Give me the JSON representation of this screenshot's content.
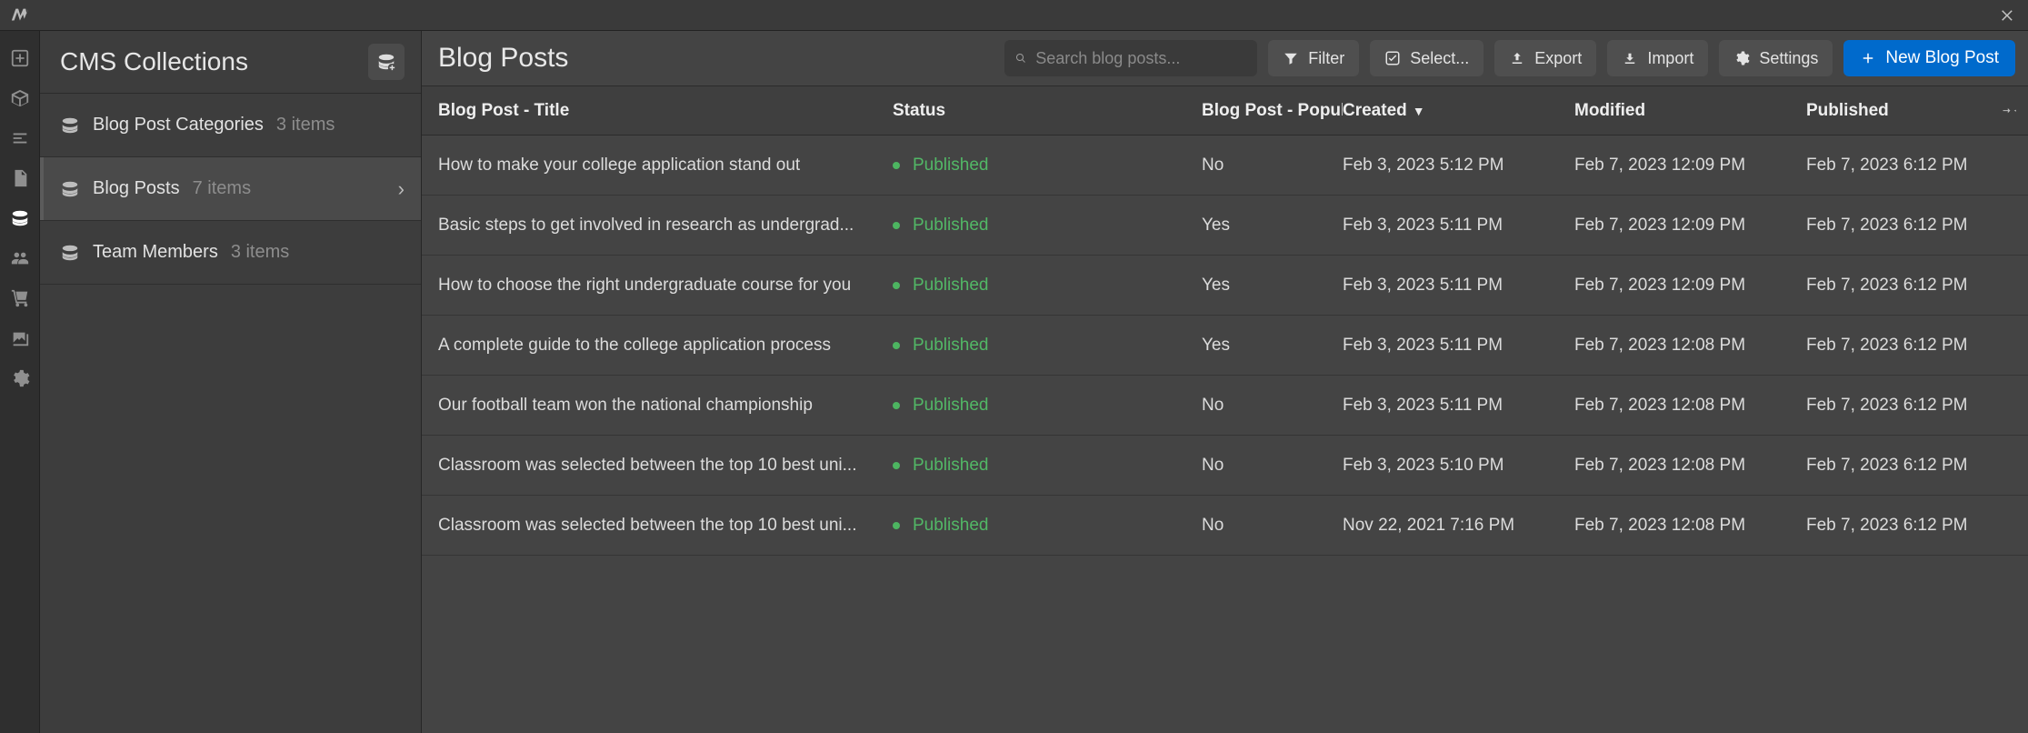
{
  "sidebar": {
    "title": "CMS Collections",
    "items": [
      {
        "name": "Blog Post Categories",
        "count": "3 items",
        "active": false
      },
      {
        "name": "Blog Posts",
        "count": "7 items",
        "active": true
      },
      {
        "name": "Team Members",
        "count": "3 items",
        "active": false
      }
    ]
  },
  "header": {
    "title": "Blog Posts",
    "search_placeholder": "Search blog posts...",
    "filter": "Filter",
    "select": "Select...",
    "export": "Export",
    "import": "Import",
    "settings": "Settings",
    "new": "New Blog Post"
  },
  "table": {
    "columns": {
      "title": "Blog Post - Title",
      "status": "Status",
      "popular": "Blog Post - Popular",
      "created": "Created",
      "modified": "Modified",
      "published": "Published"
    },
    "sort_indicator": "▼",
    "rows": [
      {
        "title": "How to make your college application stand out",
        "status": "Published",
        "popular": "No",
        "created": "Feb 3, 2023 5:12 PM",
        "modified": "Feb 7, 2023 12:09 PM",
        "published": "Feb 7, 2023 6:12 PM"
      },
      {
        "title": "Basic steps to get involved in research as undergrad...",
        "status": "Published",
        "popular": "Yes",
        "created": "Feb 3, 2023 5:11 PM",
        "modified": "Feb 7, 2023 12:09 PM",
        "published": "Feb 7, 2023 6:12 PM"
      },
      {
        "title": "How to choose the right undergraduate course for you",
        "status": "Published",
        "popular": "Yes",
        "created": "Feb 3, 2023 5:11 PM",
        "modified": "Feb 7, 2023 12:09 PM",
        "published": "Feb 7, 2023 6:12 PM"
      },
      {
        "title": "A complete guide to the college application process",
        "status": "Published",
        "popular": "Yes",
        "created": "Feb 3, 2023 5:11 PM",
        "modified": "Feb 7, 2023 12:08 PM",
        "published": "Feb 7, 2023 6:12 PM"
      },
      {
        "title": "Our football team won the national championship",
        "status": "Published",
        "popular": "No",
        "created": "Feb 3, 2023 5:11 PM",
        "modified": "Feb 7, 2023 12:08 PM",
        "published": "Feb 7, 2023 6:12 PM"
      },
      {
        "title": "Classroom was selected between the top 10 best uni...",
        "status": "Published",
        "popular": "No",
        "created": "Feb 3, 2023 5:10 PM",
        "modified": "Feb 7, 2023 12:08 PM",
        "published": "Feb 7, 2023 6:12 PM"
      },
      {
        "title": "Classroom was selected between the top 10 best uni...",
        "status": "Published",
        "popular": "No",
        "created": "Nov 22, 2021 7:16 PM",
        "modified": "Feb 7, 2023 12:08 PM",
        "published": "Feb 7, 2023 6:12 PM"
      }
    ]
  }
}
